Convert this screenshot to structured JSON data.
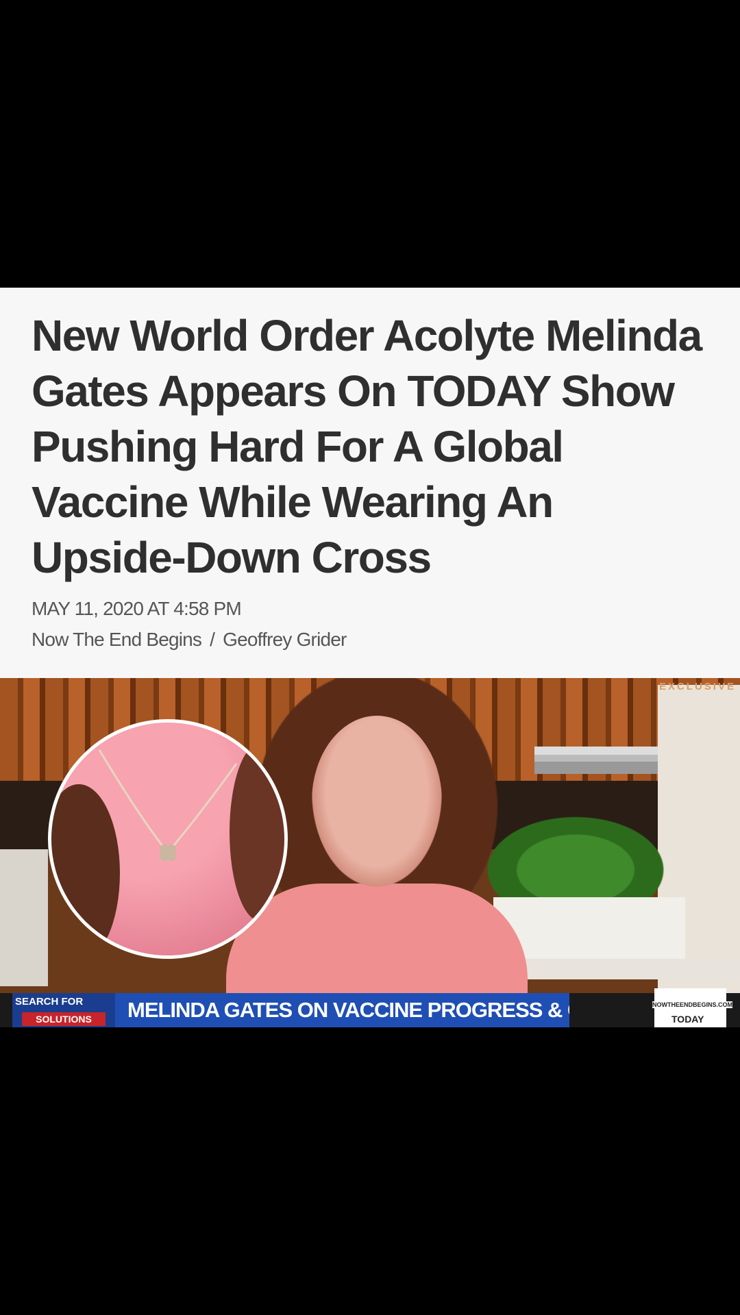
{
  "article": {
    "headline": "New World Order Acolyte Melinda Gates Appears On TODAY Show Pushing Hard For A Global Vaccine While Wearing An Upside-Down Cross",
    "date": "MAY 11, 2020 AT 4:58 PM",
    "site": "Now The End Begins",
    "separator": "/",
    "author": "Geoffrey Grider"
  },
  "image": {
    "exclusive_tag": "EXCLUSIVE",
    "chyron_brand_top": "SEARCH FOR",
    "chyron_brand_bottom": "SOLUTIONS",
    "chyron_text": "MELINDA GATES ON VACCINE PROGRESS & CAREGIVING CRISIS",
    "watermark_site": "NOWTHEENDBEGINS.COM",
    "watermark_show": "TODAY"
  }
}
